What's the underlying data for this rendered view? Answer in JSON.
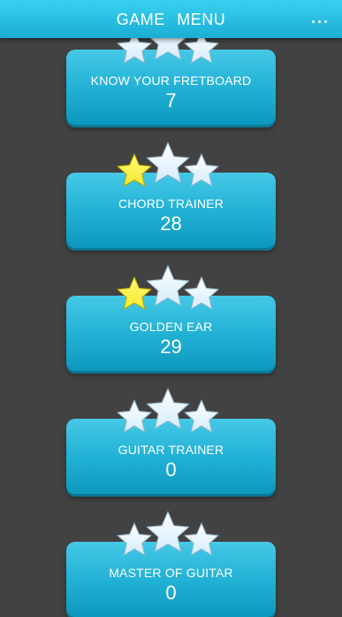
{
  "header": {
    "title": "GAME  MENU",
    "overflow_icon": "more-dots-icon"
  },
  "colors": {
    "background": "#424242",
    "accent": "#22b2d6",
    "star_filled": "#f5e92e",
    "star_empty": "#d4ecfb"
  },
  "games": [
    {
      "label": "KNOW YOUR FRETBOARD",
      "score": "7",
      "stars_earned": 0,
      "stars_total": 3
    },
    {
      "label": "CHORD TRAINER",
      "score": "28",
      "stars_earned": 1,
      "stars_total": 3
    },
    {
      "label": "GOLDEN EAR",
      "score": "29",
      "stars_earned": 1,
      "stars_total": 3
    },
    {
      "label": "GUITAR TRAINER",
      "score": "0",
      "stars_earned": 0,
      "stars_total": 3
    },
    {
      "label": "MASTER OF GUITAR",
      "score": "0",
      "stars_earned": 0,
      "stars_total": 3
    }
  ]
}
